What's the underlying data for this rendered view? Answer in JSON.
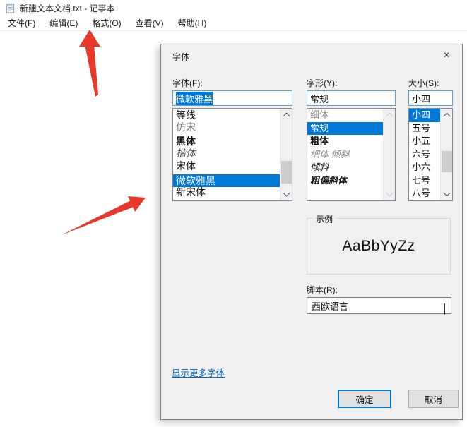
{
  "window": {
    "title": "新建文本文档.txt - 记事本",
    "menu": [
      {
        "text": "文件(F)"
      },
      {
        "text": "编辑(E)"
      },
      {
        "text": "格式(O)"
      },
      {
        "text": "查看(V)"
      },
      {
        "text": "帮助(H)"
      }
    ]
  },
  "dialog": {
    "title": "字体",
    "close_glyph": "×",
    "font": {
      "label": "字体(F):",
      "value": "微软雅黑",
      "items": [
        {
          "text": "等线",
          "cls": ""
        },
        {
          "text": "仿宋",
          "cls": "fang"
        },
        {
          "text": "黑体",
          "cls": "hei"
        },
        {
          "text": "楷体",
          "cls": "kai"
        },
        {
          "text": "宋体",
          "cls": "song"
        },
        {
          "text": "微软雅黑",
          "cls": "selected"
        },
        {
          "text": "新宋体",
          "cls": "song"
        }
      ]
    },
    "style": {
      "label": "字形(Y):",
      "value": "常规",
      "items": [
        {
          "text": "细体",
          "cls": "light"
        },
        {
          "text": "常规",
          "cls": "selected"
        },
        {
          "text": "粗体",
          "cls": "bold"
        },
        {
          "text": "细体 倾斜",
          "cls": "light italic"
        },
        {
          "text": "倾斜",
          "cls": "italic"
        },
        {
          "text": "粗偏斜体",
          "cls": "bold italic"
        }
      ]
    },
    "size": {
      "label": "大小(S):",
      "value": "小四",
      "items": [
        {
          "text": "小四",
          "cls": "selected"
        },
        {
          "text": "五号",
          "cls": ""
        },
        {
          "text": "小五",
          "cls": ""
        },
        {
          "text": "六号",
          "cls": ""
        },
        {
          "text": "小六",
          "cls": ""
        },
        {
          "text": "七号",
          "cls": ""
        },
        {
          "text": "八号",
          "cls": ""
        }
      ]
    },
    "sample": {
      "label": "示例",
      "text": "AaBbYyZz"
    },
    "script": {
      "label": "脚本(R):",
      "value": "西欧语言"
    },
    "more_fonts": "显示更多字体",
    "buttons": {
      "ok": "确定",
      "cancel": "取消"
    }
  },
  "colors": {
    "accent": "#0078d7",
    "link": "#0563c1",
    "arrow": "#e8382a"
  }
}
